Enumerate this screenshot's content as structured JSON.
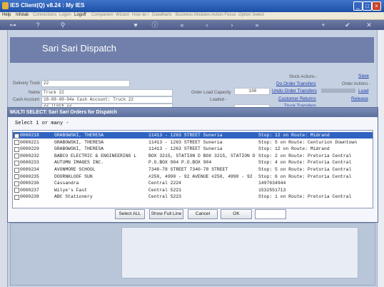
{
  "window": {
    "title": "IES Client(Q) v8.24 : My IES",
    "controls": [
      "_",
      "□",
      "×"
    ]
  },
  "menu": [
    "Help",
    "Infolab",
    "Connections",
    "Logon",
    "Logoff",
    "Companion",
    "Wizard",
    "How do I",
    "DataMarts",
    "Business Modules",
    "Action Focus",
    "Option Select"
  ],
  "form": {
    "heading": "Sari Sari Dispatch",
    "delivery_truck_label": "Delivery Truck",
    "delivery_truck_value": "22",
    "name_label": "Name",
    "name_value": "Truck 22",
    "cash_account_label": "Cash Account",
    "cash_account_value": "18-08-00-04e Cash Account: Truck 22",
    "partial_field_value": "22 Truck 22",
    "order_load_capacity_label": "Order Load Capacity",
    "order_load_capacity_value": "100",
    "loaded_label": "Loaded -",
    "stock_actions": "Stock Actions -",
    "do_order_transfers": "Do Order Transfers",
    "undo_order_transfers": "Undo Order Transfers",
    "customer_returns": "Customer Returns",
    "truck_transfers": "Truck Transfers",
    "save": "Save",
    "order_actions": "Order Actions -",
    "load": "Load",
    "release": "Release"
  },
  "dialog": {
    "title": "MULTI SELECT: Sari Sari Orders for Dispatch",
    "prompt": "Select 1 or many -",
    "rows": [
      {
        "id": "0000218",
        "name": "GRABOWSKI, THERESA",
        "address": "11413 - 1263 STREET Suneria",
        "route": "Stop: 12 on Route: Midrand",
        "selected": true
      },
      {
        "id": "0000221",
        "name": "GRABOWSKI, THERESA",
        "address": "11413 - 1263 STREET Suneria",
        "route": "Stop: 5 on Route: Centurion Downtown",
        "selected": false
      },
      {
        "id": "0000229",
        "name": "GRABOWSKI, THERESA",
        "address": "11413 - 1263 STREET Suneria",
        "route": "Stop: 12 on Route: Midrand",
        "selected": false
      },
      {
        "id": "0000232",
        "name": "BABCO ELECTRIC & ENGINEERING L",
        "address": "BOX 3215, STATION D BOX 3215, STATION D",
        "route": "Stop: 2 on Route: Pretoria Central",
        "selected": false
      },
      {
        "id": "0000233",
        "name": "AUTUMN IMAGES INC.",
        "address": "P.O.BOX 904 P.O.BOX 904",
        "route": "Stop: 4 on Route: Pretoria Central",
        "selected": false
      },
      {
        "id": "0000234",
        "name": "AVONMORE SCHOOL",
        "address": "7340-78 STREET 7340-78 STREET",
        "route": "Stop: 5 on Route: Pretoria Central",
        "selected": false
      },
      {
        "id": "0000235",
        "name": "DOORNKLOOF SUN",
        "address": "#250, 4990 - 92 AVENUE #250, 4990 - 92 A",
        "route": "Stop: 6 on Route: Pretoria Central",
        "selected": false
      },
      {
        "id": "0000236",
        "name": "Cassandra",
        "address": "Central 2224",
        "route": "1497634944",
        "selected": false
      },
      {
        "id": "0000237",
        "name": "Wilye's Fast",
        "address": "Central 5221",
        "route": "1532551713",
        "selected": false
      },
      {
        "id": "0000238",
        "name": "ABC Stationery",
        "address": "Central 5223",
        "route": "Stop: 1 on Route: Pretoria Central",
        "selected": false
      }
    ],
    "buttons": {
      "select_all": "Select ALL",
      "show_full_line": "Show Full Line",
      "cancel": "Cancel",
      "ok": "OK"
    }
  }
}
